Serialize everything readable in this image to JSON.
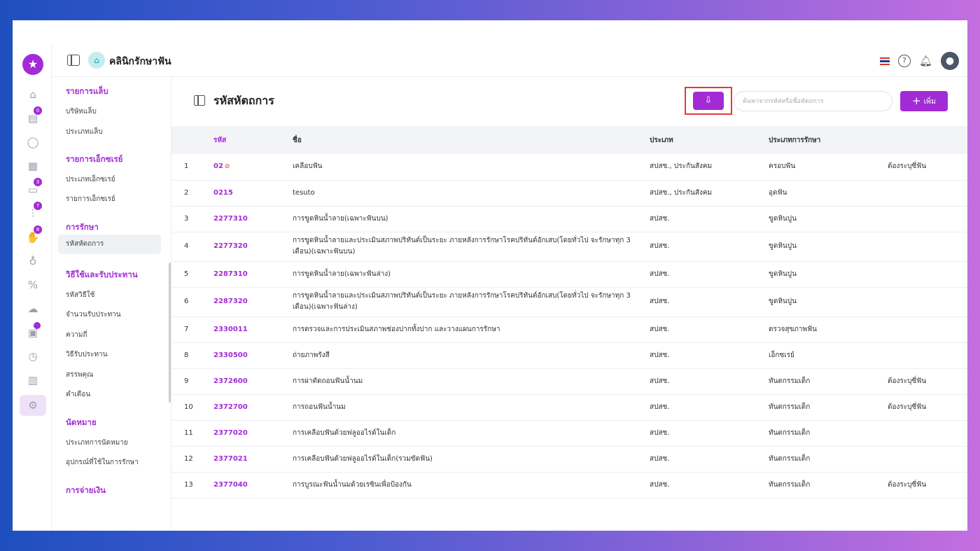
{
  "app": {
    "clinic_name": "คลินิกรักษาฟัน",
    "rail_logo_icon": "star-icon",
    "clinic_logo_icon": "house-plus-icon"
  },
  "rail": {
    "badges": {
      "calendar": "0",
      "bed": "3",
      "tools": "7",
      "hand": "8"
    }
  },
  "sidebar": {
    "sections": [
      {
        "heading": "รายการแล็บ",
        "items": [
          "บริษัทแล็บ",
          "ประเภทแล็บ"
        ]
      },
      {
        "heading": "รายการเอ็กซเรย์",
        "items": [
          "ประเภทเอ็กซเรย์",
          "รายการเอ็กซเรย์"
        ]
      },
      {
        "heading": "การรักษา",
        "items": [
          "รหัสหัตถการ"
        ]
      },
      {
        "heading": "วิธีใช้และรับประทาน",
        "items": [
          "รหัสวิธีใช้",
          "จำนวนรับประทาน",
          "ความถี่",
          "วิธีรับประทาน",
          "สรรพคุณ",
          "คำเตือน"
        ]
      },
      {
        "heading": "นัดหมาย",
        "items": [
          "ประเภทการนัดหมาย",
          "อุปกรณ์ที่ใช้ในการรักษา"
        ]
      },
      {
        "heading": "การจ่ายเงิน",
        "items": []
      }
    ]
  },
  "page": {
    "title": "รหัสหัตถการ",
    "search_placeholder": "ค้นหาจากรหัสหรือชื่อหัตถการ",
    "add_label": "เพิ่ม",
    "export_icon": "file-download-icon"
  },
  "table": {
    "headers": [
      "",
      "รหัส",
      "ชื่อ",
      "ประเภท",
      "ประเภทการรักษา",
      ""
    ],
    "rows": [
      {
        "no": "1",
        "code": "02",
        "name": "เคลือบฟัน",
        "type": "สปสช., ประกันสังคม",
        "treatment": "ครอบฟัน",
        "extra": "ต้องระบุซี่ฟัน"
      },
      {
        "no": "2",
        "code": "0215",
        "name": "tesuto",
        "type": "สปสช., ประกันสังคม",
        "treatment": "อุดฟัน",
        "extra": ""
      },
      {
        "no": "3",
        "code": "2277310",
        "name": "การขูดหินน้ำลาย(เฉพาะฟันบน)",
        "type": "สปสช.",
        "treatment": "ขูดหินปูน",
        "extra": ""
      },
      {
        "no": "4",
        "code": "2277320",
        "name": "การขูดหินน้ำลายและประเมินสภาพปริทันต์เป็นระยะ ภายหลังการรักษาโรคปริทันต์อักเสบ(โดยทั่วไป จะรักษาทุก 3 เดือน)(เฉพาะฟันบน)",
        "type": "สปสช.",
        "treatment": "ขูดหินปูน",
        "extra": ""
      },
      {
        "no": "5",
        "code": "2287310",
        "name": "การขูดหินน้ำลาย(เฉพาะฟันล่าง)",
        "type": "สปสช.",
        "treatment": "ขูดหินปูน",
        "extra": ""
      },
      {
        "no": "6",
        "code": "2287320",
        "name": "การขูดหินน้ำลายและประเมินสภาพปริทันต์เป็นระยะ ภายหลังการรักษาโรคปริทันต์อักเสบ(โดยทั่วไป จะรักษาทุก 3 เดือน)(เฉพาะฟันล่าง)",
        "type": "สปสช.",
        "treatment": "ขูดหินปูน",
        "extra": ""
      },
      {
        "no": "7",
        "code": "2330011",
        "name": "การตรวจและการประเมินสภาพช่องปากทั้งปาก และวางแผนการรักษา",
        "type": "สปสช.",
        "treatment": "ตรวจสุขภาพฟัน",
        "extra": ""
      },
      {
        "no": "8",
        "code": "2330500",
        "name": "ถ่ายภาพรังสี",
        "type": "สปสช.",
        "treatment": "เอ็กซเรย์",
        "extra": ""
      },
      {
        "no": "9",
        "code": "2372600",
        "name": "การผ่าตัดถอนฟันน้ำนม",
        "type": "สปสช.",
        "treatment": "ทันตกรรมเด็ก",
        "extra": "ต้องระบุซี่ฟัน"
      },
      {
        "no": "10",
        "code": "2372700",
        "name": "การถอนฟันน้ำนม",
        "type": "สปสช.",
        "treatment": "ทันตกรรมเด็ก",
        "extra": "ต้องระบุซี่ฟัน"
      },
      {
        "no": "11",
        "code": "2377020",
        "name": "การเคลือบฟันด้วยฟลูออไรด์ในเด็ก",
        "type": "สปสช.",
        "treatment": "ทันตกรรมเด็ก",
        "extra": ""
      },
      {
        "no": "12",
        "code": "2377021",
        "name": "การเคลือบฟันด้วยฟลูออไรด์ในเด็ก(รวมขัดฟัน)",
        "type": "สปสช.",
        "treatment": "ทันตกรรมเด็ก",
        "extra": ""
      },
      {
        "no": "13",
        "code": "2377040",
        "name": "การบูรณะฟันน้ำนมด้วยเรซินเพื่อป้องกัน",
        "type": "สปสช.",
        "treatment": "ทันตกรรมเด็ก",
        "extra": "ต้องระบุซี่ฟัน"
      }
    ]
  }
}
